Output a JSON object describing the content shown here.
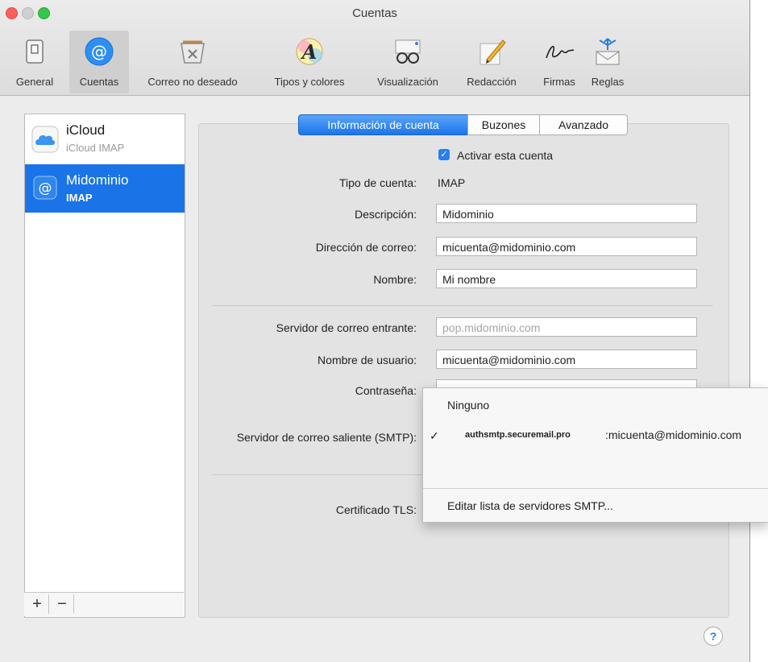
{
  "window": {
    "title": "Cuentas"
  },
  "toolbar": [
    {
      "label": "General",
      "icon": "general-switch-icon"
    },
    {
      "label": "Cuentas",
      "icon": "at-sign-icon"
    },
    {
      "label": "Correo no deseado",
      "icon": "junk-bin-icon"
    },
    {
      "label": "Tipos y colores",
      "icon": "font-a-icon"
    },
    {
      "label": "Visualización",
      "icon": "glasses-icon"
    },
    {
      "label": "Redacción",
      "icon": "pencil-icon"
    },
    {
      "label": "Firmas",
      "icon": "signature-icon"
    },
    {
      "label": "Reglas",
      "icon": "rules-envelope-icon"
    }
  ],
  "accounts": [
    {
      "name": "iCloud",
      "type": "iCloud IMAP",
      "icon": "cloud-icon"
    },
    {
      "name": "Midominio",
      "type": "IMAP",
      "icon": "at-sign-icon"
    }
  ],
  "account_buttons": {
    "add": "+",
    "remove": "−"
  },
  "tabs": [
    "Información de cuenta",
    "Buzones",
    "Avanzado"
  ],
  "form": {
    "enable_label": "Activar esta cuenta",
    "account_type_label": "Tipo de cuenta:",
    "account_type_value": "IMAP",
    "description_label": "Descripción:",
    "description_value": "Midominio",
    "email_label": "Dirección de correo:",
    "email_value": "micuenta@midominio.com",
    "name_label": "Nombre:",
    "name_value": "Mi nombre",
    "incoming_label": "Servidor de correo entrante:",
    "incoming_value": "pop.midominio.com",
    "username_label": "Nombre de usuario:",
    "username_value": "micuenta@midominio.com",
    "password_label": "Contraseña:",
    "smtp_label": "Servidor de correo saliente (SMTP):",
    "tls_label": "Certificado TLS:"
  },
  "smtp_menu": {
    "none": "Ninguno",
    "check": "✓",
    "server": "authsmtp.securemail.pro",
    "server_account": ":micuenta@midominio.com",
    "edit": "Editar lista de servidores SMTP..."
  },
  "help": "?",
  "colors": {
    "accent": "#1a74e8",
    "window_bg": "#ececec"
  }
}
